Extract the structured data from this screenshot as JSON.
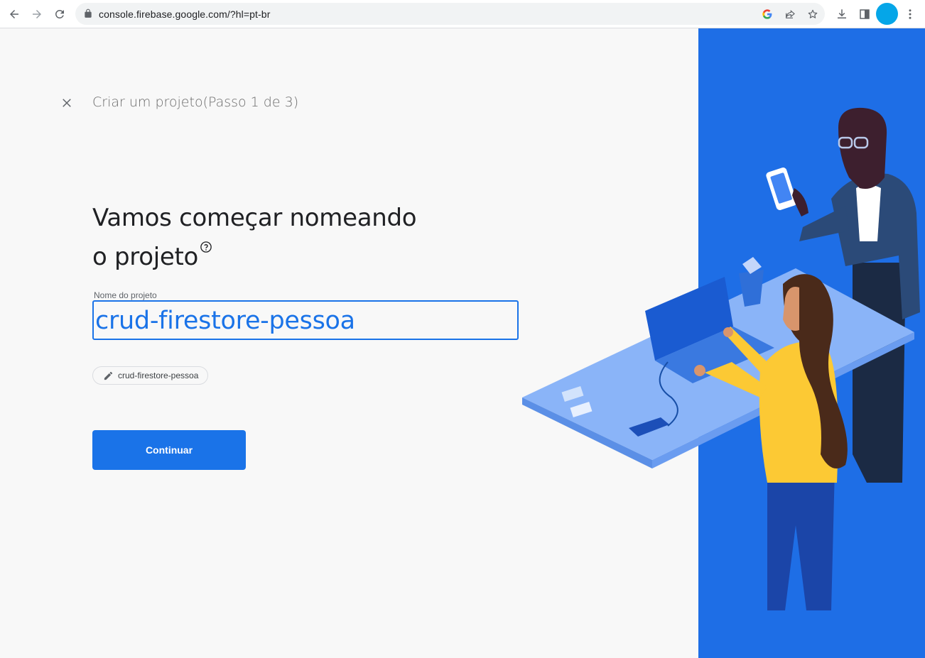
{
  "browser": {
    "url": "console.firebase.google.com/?hl=pt-br",
    "profile_color": "#05a6e8"
  },
  "page": {
    "step_title": "Criar um projeto(Passo 1 de 3)",
    "heading_line1": "Vamos começar nomeando",
    "heading_line2": "o projeto",
    "field_label": "Nome do projeto",
    "project_name_value": "crud-firestore-pessoa",
    "project_id_chip": "crud-firestore-pessoa",
    "continue_label": "Continuar"
  },
  "colors": {
    "accent": "#1a73e8",
    "illustration_panel": "#1e6ee6"
  }
}
